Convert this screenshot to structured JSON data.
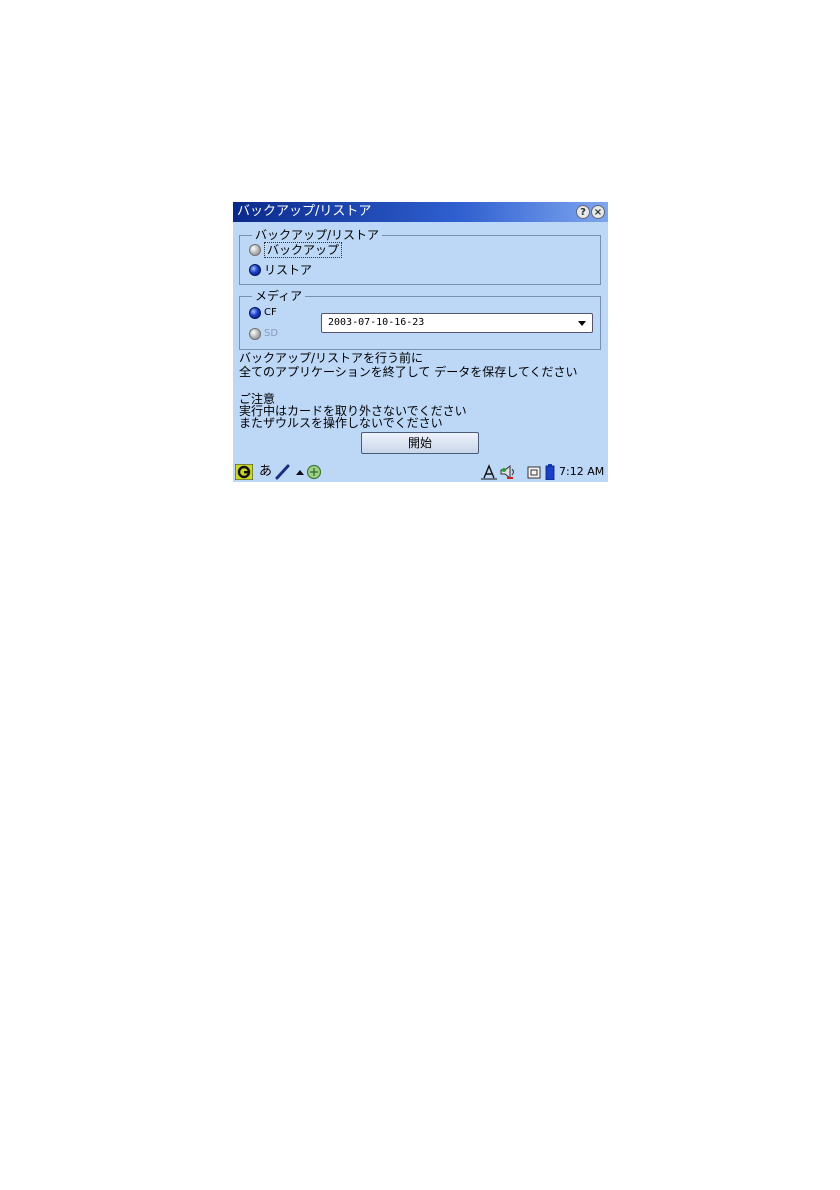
{
  "window": {
    "title": "バックアップ/リストア",
    "help_glyph": "?",
    "close_glyph": "×"
  },
  "mode_group": {
    "legend": "バックアップ/リストア",
    "options": [
      {
        "label": "バックアップ",
        "selected": false
      },
      {
        "label": "リストア",
        "selected": true
      }
    ]
  },
  "media_group": {
    "legend": "メディア",
    "options": [
      {
        "label": "CF",
        "selected": true
      },
      {
        "label": "SD",
        "selected": false,
        "disabled": true
      }
    ],
    "backup_select_value": "2003-07-10-16-23"
  },
  "messages": {
    "line1": "バックアップ/リストアを行う前に",
    "line2": "全てのアプリケーションを終了して データを保存してください",
    "line3": "ご注意",
    "line4": "実行中はカードを取り外さないでください",
    "line5": "またザウルスを操作しないでください"
  },
  "start_button": {
    "label": "開始"
  },
  "taskbar": {
    "ime_label": "あ",
    "clock": "7:12 AM",
    "icons": [
      "launcher-icon",
      "pen-icon",
      "up-arrow-icon",
      "network-icon",
      "font-a-icon",
      "speaker-icon",
      "card-icon",
      "battery-icon"
    ]
  },
  "colors": {
    "background": "#bdd7f7",
    "titlebar": "#0a2a8a",
    "radio_on": "#1a3fc9"
  }
}
